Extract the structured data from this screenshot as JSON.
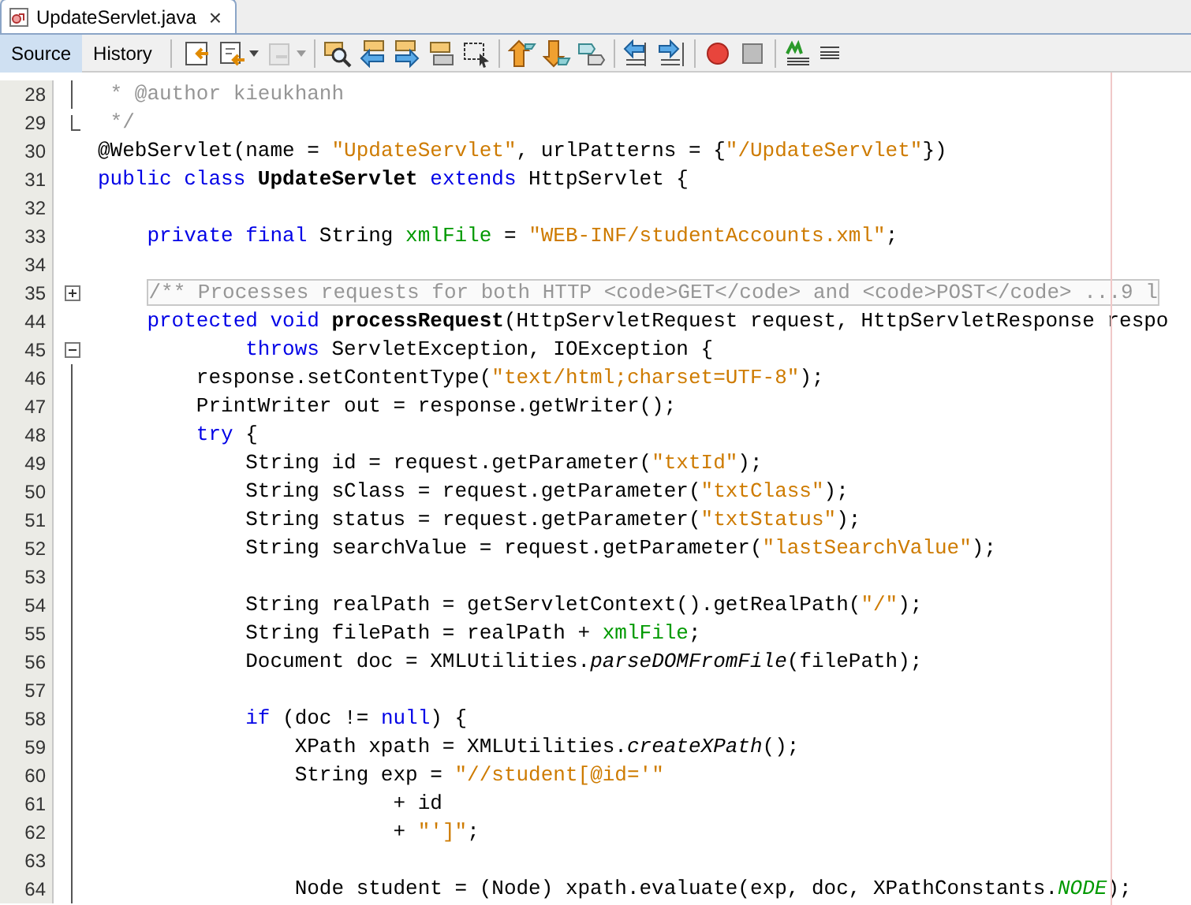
{
  "file_tab": {
    "title": "UpdateServlet.java",
    "close": "×",
    "selected": true
  },
  "views": [
    {
      "label": "Source",
      "selected": true
    },
    {
      "label": "History",
      "selected": false
    }
  ],
  "toolbar": [
    {
      "kind": "last-edit",
      "disabled": false,
      "dropdown": false
    },
    {
      "kind": "back",
      "disabled": false,
      "dropdown": true
    },
    {
      "kind": "forward",
      "disabled": true,
      "dropdown": true
    },
    {
      "kind": "sep"
    },
    {
      "kind": "find",
      "disabled": false,
      "dropdown": false
    },
    {
      "kind": "find-prev",
      "disabled": false,
      "dropdown": false
    },
    {
      "kind": "find-next",
      "disabled": false,
      "dropdown": false
    },
    {
      "kind": "highlight",
      "disabled": false,
      "dropdown": false
    },
    {
      "kind": "select",
      "disabled": false,
      "dropdown": false
    },
    {
      "kind": "sep"
    },
    {
      "kind": "up",
      "disabled": false,
      "dropdown": false
    },
    {
      "kind": "down",
      "disabled": false,
      "dropdown": false
    },
    {
      "kind": "shapes",
      "disabled": false,
      "dropdown": false
    },
    {
      "kind": "sep"
    },
    {
      "kind": "shift-left",
      "disabled": false,
      "dropdown": false
    },
    {
      "kind": "shift-right",
      "disabled": false,
      "dropdown": false
    },
    {
      "kind": "sep"
    },
    {
      "kind": "record",
      "disabled": false,
      "dropdown": false
    },
    {
      "kind": "stop",
      "disabled": false,
      "dropdown": false
    },
    {
      "kind": "sep"
    },
    {
      "kind": "check",
      "disabled": false,
      "dropdown": false
    },
    {
      "kind": "lines",
      "disabled": false,
      "dropdown": false
    }
  ],
  "lines": [
    {
      "number": "28",
      "fold": {
        "kind": "line"
      },
      "tokens": [
        {
          "text": " * @author kieukhanh",
          "kind": "comment"
        }
      ]
    },
    {
      "number": "29",
      "fold": {
        "kind": "end"
      },
      "tokens": [
        {
          "text": " */",
          "kind": "comment"
        }
      ]
    },
    {
      "number": "30",
      "tokens": [
        {
          "text": "@WebServlet(name = ",
          "kind": "plain"
        },
        {
          "text": "\"UpdateServlet\"",
          "kind": "string"
        },
        {
          "text": ", urlPatterns = {",
          "kind": "plain"
        },
        {
          "text": "\"/UpdateServlet\"",
          "kind": "string"
        },
        {
          "text": "})",
          "kind": "plain"
        }
      ]
    },
    {
      "number": "31",
      "tokens": [
        {
          "text": "public class ",
          "kind": "keyword"
        },
        {
          "text": "UpdateServlet ",
          "kind": "bold"
        },
        {
          "text": "extends",
          "kind": "keyword"
        },
        {
          "text": " HttpServlet {",
          "kind": "plain"
        }
      ]
    },
    {
      "number": "32"
    },
    {
      "number": "33",
      "tokens": [
        {
          "text": "    private final",
          "kind": "keyword"
        },
        {
          "text": " String ",
          "kind": "plain"
        },
        {
          "text": "xmlFile",
          "kind": "field"
        },
        {
          "text": " = ",
          "kind": "plain"
        },
        {
          "text": "\"WEB-INF/studentAccounts.xml\"",
          "kind": "string"
        },
        {
          "text": ";",
          "kind": "plain"
        }
      ]
    },
    {
      "number": "34"
    },
    {
      "number": "35",
      "fold": {
        "kind": "expand"
      },
      "tokens": [
        {
          "text": "    /** Processes requests for both HTTP <code>GET</code> and <code>POST</code> ...9 l",
          "kind": "folded"
        }
      ]
    },
    {
      "number": "44",
      "tokens": [
        {
          "text": "    protected void ",
          "kind": "keyword"
        },
        {
          "text": "processRequest",
          "kind": "bold"
        },
        {
          "text": "(HttpServletRequest request, HttpServletResponse respo",
          "kind": "plain"
        }
      ]
    },
    {
      "number": "45",
      "fold": {
        "kind": "collapse"
      },
      "tokens": [
        {
          "text": "            throws",
          "kind": "keyword"
        },
        {
          "text": " ServletException, IOException {",
          "kind": "plain"
        }
      ]
    },
    {
      "number": "46",
      "fold": {
        "kind": "line"
      },
      "tokens": [
        {
          "text": "        response.setContentType(",
          "kind": "plain"
        },
        {
          "text": "\"text/html;charset=UTF-8\"",
          "kind": "string"
        },
        {
          "text": ");",
          "kind": "plain"
        }
      ]
    },
    {
      "number": "47",
      "fold": {
        "kind": "line"
      },
      "tokens": [
        {
          "text": "        PrintWriter out = response.getWriter();",
          "kind": "plain"
        }
      ]
    },
    {
      "number": "48",
      "fold": {
        "kind": "line"
      },
      "tokens": [
        {
          "text": "        try",
          "kind": "keyword"
        },
        {
          "text": " {",
          "kind": "plain"
        }
      ]
    },
    {
      "number": "49",
      "fold": {
        "kind": "line"
      },
      "tokens": [
        {
          "text": "            String id = request.getParameter(",
          "kind": "plain"
        },
        {
          "text": "\"txtId\"",
          "kind": "string"
        },
        {
          "text": ");",
          "kind": "plain"
        }
      ]
    },
    {
      "number": "50",
      "fold": {
        "kind": "line"
      },
      "tokens": [
        {
          "text": "            String sClass = request.getParameter(",
          "kind": "plain"
        },
        {
          "text": "\"txtClass\"",
          "kind": "string"
        },
        {
          "text": ");",
          "kind": "plain"
        }
      ]
    },
    {
      "number": "51",
      "fold": {
        "kind": "line"
      },
      "tokens": [
        {
          "text": "            String status = request.getParameter(",
          "kind": "plain"
        },
        {
          "text": "\"txtStatus\"",
          "kind": "string"
        },
        {
          "text": ");",
          "kind": "plain"
        }
      ]
    },
    {
      "number": "52",
      "fold": {
        "kind": "line"
      },
      "tokens": [
        {
          "text": "            String searchValue = request.getParameter(",
          "kind": "plain"
        },
        {
          "text": "\"lastSearchValue\"",
          "kind": "string"
        },
        {
          "text": ");",
          "kind": "plain"
        }
      ]
    },
    {
      "number": "53",
      "fold": {
        "kind": "line"
      }
    },
    {
      "number": "54",
      "fold": {
        "kind": "line"
      },
      "tokens": [
        {
          "text": "            String realPath = getServletContext().getRealPath(",
          "kind": "plain"
        },
        {
          "text": "\"/\"",
          "kind": "string"
        },
        {
          "text": ");",
          "kind": "plain"
        }
      ]
    },
    {
      "number": "55",
      "fold": {
        "kind": "line"
      },
      "tokens": [
        {
          "text": "            String filePath = realPath + ",
          "kind": "plain"
        },
        {
          "text": "xmlFile",
          "kind": "field"
        },
        {
          "text": ";",
          "kind": "plain"
        }
      ]
    },
    {
      "number": "56",
      "fold": {
        "kind": "line"
      },
      "tokens": [
        {
          "text": "            Document doc = XMLUtilities.",
          "kind": "plain"
        },
        {
          "text": "parseDOMFromFile",
          "kind": "italic"
        },
        {
          "text": "(filePath);",
          "kind": "plain"
        }
      ]
    },
    {
      "number": "57",
      "fold": {
        "kind": "line"
      }
    },
    {
      "number": "58",
      "fold": {
        "kind": "line"
      },
      "tokens": [
        {
          "text": "            if",
          "kind": "keyword"
        },
        {
          "text": " (doc != ",
          "kind": "plain"
        },
        {
          "text": "null",
          "kind": "keyword"
        },
        {
          "text": ") {",
          "kind": "plain"
        }
      ]
    },
    {
      "number": "59",
      "fold": {
        "kind": "line"
      },
      "tokens": [
        {
          "text": "                XPath xpath = XMLUtilities.",
          "kind": "plain"
        },
        {
          "text": "createXPath",
          "kind": "italic"
        },
        {
          "text": "();",
          "kind": "plain"
        }
      ]
    },
    {
      "number": "60",
      "fold": {
        "kind": "line"
      },
      "tokens": [
        {
          "text": "                String exp = ",
          "kind": "plain"
        },
        {
          "text": "\"//student[@id='\"",
          "kind": "string"
        }
      ]
    },
    {
      "number": "61",
      "fold": {
        "kind": "line"
      },
      "tokens": [
        {
          "text": "                        + id",
          "kind": "plain"
        }
      ]
    },
    {
      "number": "62",
      "fold": {
        "kind": "line"
      },
      "tokens": [
        {
          "text": "                        + ",
          "kind": "plain"
        },
        {
          "text": "\"']\"",
          "kind": "string"
        },
        {
          "text": ";",
          "kind": "plain"
        }
      ]
    },
    {
      "number": "63",
      "fold": {
        "kind": "line"
      }
    },
    {
      "number": "64",
      "fold": {
        "kind": "line"
      },
      "tokens": [
        {
          "text": "                Node student = (Node) xpath.evaluate(exp, doc, XPathConstants.",
          "kind": "plain"
        },
        {
          "text": "NODE",
          "kind": "field-italic"
        },
        {
          "text": ");",
          "kind": "plain"
        }
      ]
    }
  ]
}
